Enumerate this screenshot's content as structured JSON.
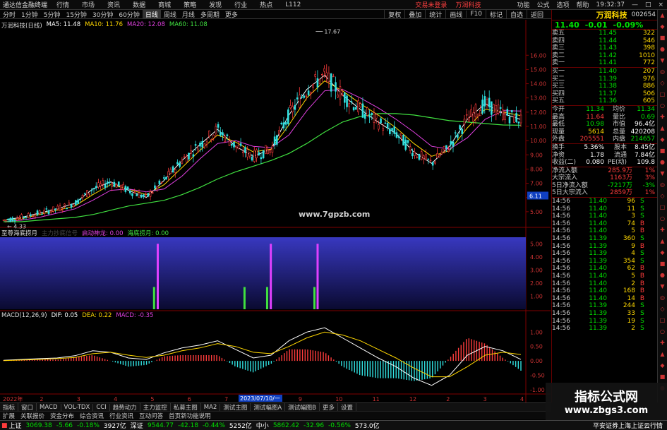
{
  "menubar": {
    "app_title": "通达信金融终端",
    "items": [
      "行情",
      "市场",
      "资讯",
      "数据",
      "商城",
      "策略",
      "发现",
      "行业",
      "热点",
      "L112"
    ],
    "highlight_items": [
      "交易未登录",
      "万润科技"
    ],
    "right_items": [
      "功能",
      "公式",
      "选项",
      "帮助",
      "19:32:37"
    ]
  },
  "toolbar": {
    "items": [
      "分时",
      "1分钟",
      "5分钟",
      "15分钟",
      "30分钟",
      "60分钟",
      "日线",
      "周线",
      "月线",
      "多周期",
      "更多"
    ],
    "active": "日线",
    "right_items": [
      "复权",
      "叠加",
      "统计",
      "画线",
      "F10",
      "标记",
      "自选",
      "返回"
    ]
  },
  "main_chart": {
    "title": "万润科技(日线)",
    "ma_labels": [
      {
        "text": "MA5: 11.48",
        "color": "#ffffff"
      },
      {
        "text": "MA10: 11.76",
        "color": "#ffd700"
      },
      {
        "text": "MA20: 12.08",
        "color": "#e040e0"
      },
      {
        "text": "MA60: 11.08",
        "color": "#40e040"
      }
    ],
    "price_axis": [
      "16.00",
      "15.00",
      "14.00",
      "13.00",
      "12.00",
      "11.00",
      "10.00",
      "9.00",
      "8.00",
      "7.00",
      "6.00",
      "5.00"
    ],
    "price_range": [
      4.0,
      17.8
    ],
    "high_label": "17.67",
    "low_label": "4.33",
    "current_price_tag": "6.11",
    "watermark_site": "www.7gpzb.com"
  },
  "indicator": {
    "title": "至尊海底捞月",
    "labels": [
      {
        "text": "主力抄底信号",
        "color": "#444444"
      },
      {
        "text": "启动神龙: 0.00",
        "color": "#e040e0"
      },
      {
        "text": "海底捞月: 0.00",
        "color": "#40e040"
      }
    ],
    "axis": [
      "5.00",
      "4.00",
      "3.00",
      "2.00",
      "1.00"
    ],
    "range": [
      0,
      5.5
    ]
  },
  "macd": {
    "title": "MACD(12,26,9)",
    "labels": [
      {
        "text": "DIF: 0.05",
        "color": "#ffffff"
      },
      {
        "text": "DEA: 0.22",
        "color": "#ffd700"
      },
      {
        "text": "MACD: -0.35",
        "color": "#e040e0"
      }
    ],
    "axis": [
      "1.00",
      "0.50",
      "0.00",
      "-0.50",
      "-1.00"
    ],
    "range": [
      -1.1,
      1.4
    ]
  },
  "date_axis": {
    "items": [
      "2022年",
      "2",
      "3",
      "4",
      "5",
      "6",
      "7",
      "8",
      "9",
      "10",
      "11",
      "12",
      "2",
      "3",
      "4"
    ],
    "cursor_date": "2023/07/10/一"
  },
  "quote": {
    "name": "万润科技",
    "code": "002654",
    "price": "11.40",
    "change": "-0.01",
    "pct": "-0.09%",
    "asks": [
      {
        "label": "卖五",
        "price": "11.45",
        "vol": "322"
      },
      {
        "label": "卖四",
        "price": "11.44",
        "vol": "546"
      },
      {
        "label": "卖三",
        "price": "11.43",
        "vol": "398"
      },
      {
        "label": "卖二",
        "price": "11.42",
        "vol": "1010"
      },
      {
        "label": "卖一",
        "price": "11.41",
        "vol": "772"
      }
    ],
    "bids": [
      {
        "label": "买一",
        "price": "11.40",
        "vol": "207"
      },
      {
        "label": "买二",
        "price": "11.39",
        "vol": "976"
      },
      {
        "label": "买三",
        "price": "11.38",
        "vol": "886"
      },
      {
        "label": "买四",
        "price": "11.37",
        "vol": "506"
      },
      {
        "label": "买五",
        "price": "11.36",
        "vol": "605"
      }
    ],
    "stats": [
      {
        "l1": "今开",
        "v1": "11.34",
        "c1": "green",
        "l2": "均价",
        "v2": "11.34",
        "c2": "green"
      },
      {
        "l1": "最高",
        "v1": "11.64",
        "c1": "red",
        "l2": "量比",
        "v2": "0.69",
        "c2": "green"
      },
      {
        "l1": "最低",
        "v1": "10.98",
        "c1": "green",
        "l2": "市值",
        "v2": "96.4亿",
        "c2": "white"
      },
      {
        "l1": "现量",
        "v1": "5614",
        "c1": "yellow",
        "l2": "总量",
        "v2": "420208",
        "c2": "white"
      },
      {
        "l1": "外盘",
        "v1": "205551",
        "c1": "red",
        "l2": "内盘",
        "v2": "214657",
        "c2": "green"
      }
    ],
    "stats2": [
      {
        "l1": "换手",
        "v1": "5.36%",
        "c1": "white",
        "l2": "股本",
        "v2": "8.45亿",
        "c2": "white"
      },
      {
        "l1": "净资",
        "v1": "1.78",
        "c1": "white",
        "l2": "流通",
        "v2": "7.84亿",
        "c2": "white"
      },
      {
        "l1": "收益(二)",
        "v1": "0.080",
        "c1": "white",
        "l2": "PE(动)",
        "v2": "109.8",
        "c2": "white"
      }
    ],
    "flows": [
      {
        "label": "净流入额",
        "value": "285.9万",
        "pct": "1%",
        "color": "red"
      },
      {
        "label": "大宗流入",
        "value": "1163万",
        "pct": "3%",
        "color": "red"
      },
      {
        "label": "5日净流入额",
        "value": "-7217万",
        "pct": "-3%",
        "color": "green"
      },
      {
        "label": "5日大宗流入",
        "value": "2859万",
        "pct": "1%",
        "color": "red"
      }
    ],
    "ticks": [
      {
        "t": "14:56",
        "p": "11.40",
        "v": "96",
        "s": "S"
      },
      {
        "t": "14:56",
        "p": "11.40",
        "v": "11",
        "s": "S"
      },
      {
        "t": "14:56",
        "p": "11.40",
        "v": "3",
        "s": "S"
      },
      {
        "t": "14:56",
        "p": "11.40",
        "v": "74",
        "s": "B"
      },
      {
        "t": "14:56",
        "p": "11.40",
        "v": "5",
        "s": "B"
      },
      {
        "t": "14:56",
        "p": "11.39",
        "v": "360",
        "s": "S"
      },
      {
        "t": "14:56",
        "p": "11.39",
        "v": "9",
        "s": "B"
      },
      {
        "t": "14:56",
        "p": "11.39",
        "v": "4",
        "s": "S"
      },
      {
        "t": "14:56",
        "p": "11.39",
        "v": "354",
        "s": "S"
      },
      {
        "t": "14:56",
        "p": "11.40",
        "v": "62",
        "s": "B"
      },
      {
        "t": "14:56",
        "p": "11.40",
        "v": "5",
        "s": "B"
      },
      {
        "t": "14:56",
        "p": "11.40",
        "v": "2",
        "s": "B"
      },
      {
        "t": "14:56",
        "p": "11.40",
        "v": "168",
        "s": "B"
      },
      {
        "t": "14:56",
        "p": "11.40",
        "v": "14",
        "s": "B"
      },
      {
        "t": "14:56",
        "p": "11.39",
        "v": "244",
        "s": "S"
      },
      {
        "t": "14:56",
        "p": "11.39",
        "v": "33",
        "s": "S"
      },
      {
        "t": "14:56",
        "p": "11.39",
        "v": "19",
        "s": "S"
      },
      {
        "t": "14:56",
        "p": "11.39",
        "v": "2",
        "s": "S"
      }
    ]
  },
  "bottom_tabs": [
    "指标",
    "窗口",
    "MACD",
    "VOL-TDX",
    "CCI",
    "趋势动力",
    "主力监控",
    "私募主图",
    "MA2",
    "测试主图",
    "测试幅图A",
    "测试幅图B",
    "更多",
    "设置"
  ],
  "sub_tabs": [
    "扩展",
    "关联报价",
    "资金分布",
    "综合资讯",
    "行业资讯",
    "互动问答",
    "首页新功能说明"
  ],
  "status_bar": {
    "idx1_name": "上证",
    "idx1_val": "3069.38",
    "idx1_chg": "-5.66",
    "idx1_pct": "-0.18%",
    "idx1_amt": "3927亿",
    "idx2_name": "深证",
    "idx2_val": "9544.77",
    "idx2_chg": "-42.18",
    "idx2_pct": "-0.44%",
    "idx2_amt": "5252亿",
    "idx3_name": "中小",
    "idx3_val": "5862.42",
    "idx3_chg": "-32.96",
    "idx3_pct": "-0.56%",
    "idx3_amt": "573.0亿",
    "right_text": "平安证券上海上证云行情"
  },
  "watermark": {
    "title": "指标公式网",
    "url": "www.zbgs3.com"
  },
  "colors": {
    "up": "#ff3c3c",
    "down": "#00e000",
    "dark_red_border": "#660000"
  },
  "chart_data": {
    "type": "line",
    "title": "万润科技(日线)",
    "series": [
      {
        "name": "MA5",
        "values": [
          4.4,
          4.6,
          4.9,
          5.2,
          5.6,
          6.6,
          7.1,
          6.5,
          6.0,
          7.2,
          8.6,
          9.7,
          10.8,
          9.6,
          8.9,
          9.4,
          11.8,
          13.6,
          14.6,
          13.2,
          12.2,
          11.3,
          10.5,
          9.2,
          8.4,
          9.6,
          11.5,
          12.6,
          11.9,
          11.48
        ]
      },
      {
        "name": "MA10",
        "values": [
          4.4,
          4.5,
          4.8,
          5.1,
          5.4,
          6.2,
          6.9,
          6.6,
          6.2,
          6.9,
          8.1,
          9.3,
          10.4,
          9.9,
          9.2,
          9.4,
          11.1,
          13.0,
          14.2,
          13.5,
          12.6,
          11.8,
          10.9,
          9.8,
          8.9,
          9.3,
          10.9,
          12.2,
          12.0,
          11.76
        ]
      },
      {
        "name": "MA20",
        "values": [
          4.3,
          4.4,
          4.6,
          4.9,
          5.2,
          5.8,
          6.5,
          6.6,
          6.4,
          6.6,
          7.5,
          8.7,
          9.8,
          10.0,
          9.6,
          9.5,
          10.4,
          12.1,
          13.5,
          13.6,
          13.0,
          12.3,
          11.5,
          10.6,
          9.6,
          9.4,
          10.2,
          11.5,
          12.1,
          12.08
        ]
      },
      {
        "name": "MA60",
        "values": [
          4.3,
          4.3,
          4.4,
          4.5,
          4.6,
          4.8,
          5.1,
          5.4,
          5.6,
          5.8,
          6.2,
          6.7,
          7.3,
          7.8,
          8.2,
          8.6,
          9.1,
          9.8,
          10.6,
          11.3,
          11.7,
          11.9,
          11.9,
          11.8,
          11.6,
          11.4,
          11.3,
          11.2,
          11.1,
          11.08
        ]
      }
    ],
    "indicator_bars": [
      {
        "pos": 0.3,
        "value": 5.0,
        "color": "magenta"
      },
      {
        "pos": 0.293,
        "value": 1.7,
        "color": "green"
      },
      {
        "pos": 0.515,
        "value": 5.0,
        "color": "magenta"
      },
      {
        "pos": 0.465,
        "value": 1.7,
        "color": "green"
      },
      {
        "pos": 0.508,
        "value": 1.7,
        "color": "green"
      },
      {
        "pos": 0.604,
        "value": 5.0,
        "color": "magenta"
      },
      {
        "pos": 0.598,
        "value": 1.7,
        "color": "green"
      }
    ],
    "macd_dif": [
      0.02,
      0.05,
      0.08,
      0.1,
      0.18,
      0.35,
      0.3,
      0.1,
      0.05,
      0.28,
      0.45,
      0.55,
      0.7,
      0.4,
      0.1,
      0.2,
      0.7,
      1.0,
      1.15,
      0.8,
      0.45,
      0.1,
      -0.2,
      -0.6,
      -0.85,
      -0.5,
      0.2,
      0.5,
      0.35,
      0.05
    ],
    "macd_dea": [
      0.01,
      0.03,
      0.05,
      0.08,
      0.12,
      0.25,
      0.3,
      0.2,
      0.12,
      0.2,
      0.35,
      0.45,
      0.6,
      0.5,
      0.3,
      0.25,
      0.5,
      0.8,
      1.0,
      0.9,
      0.7,
      0.4,
      0.1,
      -0.25,
      -0.55,
      -0.55,
      -0.2,
      0.2,
      0.3,
      0.22
    ]
  }
}
